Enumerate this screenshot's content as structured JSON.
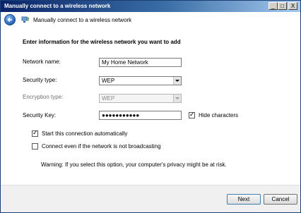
{
  "window": {
    "title": "Manually connect to a wireless network",
    "controls": {
      "minimize": "_",
      "maximize": "□",
      "close": "X"
    }
  },
  "header": {
    "page_title": "Manually connect to a wireless network"
  },
  "form": {
    "heading": "Enter information for the wireless network you want to add",
    "network_name": {
      "label": "Network name:",
      "value": "My Home Network"
    },
    "security_type": {
      "label": "Security type:",
      "value": "WEP"
    },
    "encryption_type": {
      "label": "Encryption type:",
      "value": "WEP",
      "enabled": false
    },
    "security_key": {
      "label": "Security Key:",
      "value": "●●●●●●●●●●●"
    },
    "hide_characters": {
      "label": "Hide characters",
      "checked": true
    },
    "start_automatically": {
      "label": "Start this connection automatically",
      "checked": true
    },
    "connect_not_broadcasting": {
      "label": "Connect even if the network is not broadcasting",
      "checked": false
    },
    "warning": "Warning: If you select this option, your computer's privacy might be at risk."
  },
  "footer": {
    "next_label": "Next",
    "cancel_label": "Cancel"
  },
  "check_mark": "✓",
  "colors": {
    "title_bar_start": "#0a246a",
    "title_bar_end": "#a6caf0",
    "back_button": "#2f6fbc"
  },
  "icons": {
    "back": "back-arrow-icon",
    "network": "wireless-network-icon"
  }
}
